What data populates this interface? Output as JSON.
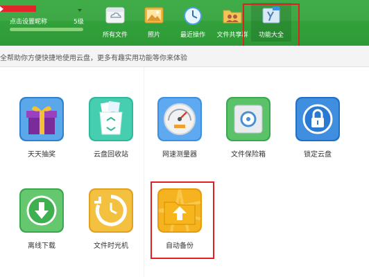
{
  "user": {
    "name": "点击设置昵称",
    "level": "5级",
    "progress": 1.0
  },
  "toolbar": [
    {
      "label": "所有文件"
    },
    {
      "label": "照片"
    },
    {
      "label": "最近操作"
    },
    {
      "label": "文件共享群"
    },
    {
      "label": "功能大全",
      "active": true
    }
  ],
  "info_text": "全帮助你方便快捷地使用云盘，更多有趣实用功能等你来体验",
  "features": [
    {
      "label": "天天抽奖",
      "icon": "gift-icon"
    },
    {
      "label": "云盘回收站",
      "icon": "recycle-bin-icon"
    },
    {
      "label": "网速测量器",
      "icon": "speedometer-icon"
    },
    {
      "label": "文件保险箱",
      "icon": "safe-icon"
    },
    {
      "label": "锁定云盘",
      "icon": "lock-icon"
    },
    {
      "label": "离线下载",
      "icon": "download-icon"
    },
    {
      "label": "文件时光机",
      "icon": "time-machine-icon"
    },
    {
      "label": "自动备份",
      "icon": "backup-folder-icon"
    }
  ],
  "colors": {
    "header_green": "#2e9a37",
    "highlight_red": "#e02020"
  }
}
